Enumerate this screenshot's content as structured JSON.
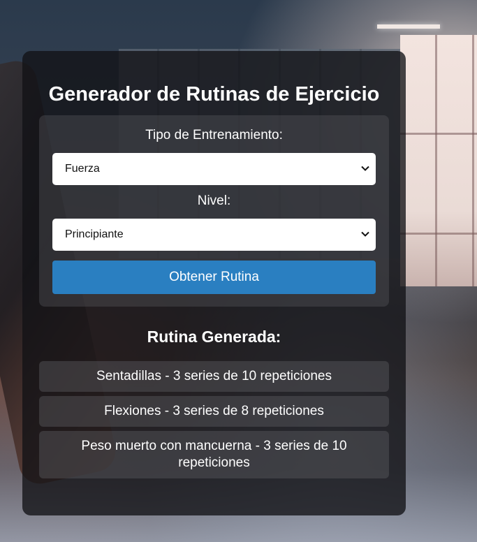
{
  "app": {
    "title": "Generador de Rutinas de Ejercicio"
  },
  "form": {
    "training_type_label": "Tipo de Entrenamiento:",
    "training_type_value": "Fuerza",
    "level_label": "Nivel:",
    "level_value": "Principiante",
    "submit_label": "Obtener Rutina"
  },
  "result": {
    "title": "Rutina Generada:",
    "items": [
      "Sentadillas - 3 series de 10 repeticiones",
      "Flexiones - 3 series de 8 repeticiones",
      "Peso muerto con mancuerna - 3 series de 10 repeticiones"
    ]
  },
  "colors": {
    "button": "#2a7fc1",
    "card_background": "#121216",
    "text": "#ffffff"
  },
  "icons": {
    "select_arrow": "chevron-down-icon"
  }
}
